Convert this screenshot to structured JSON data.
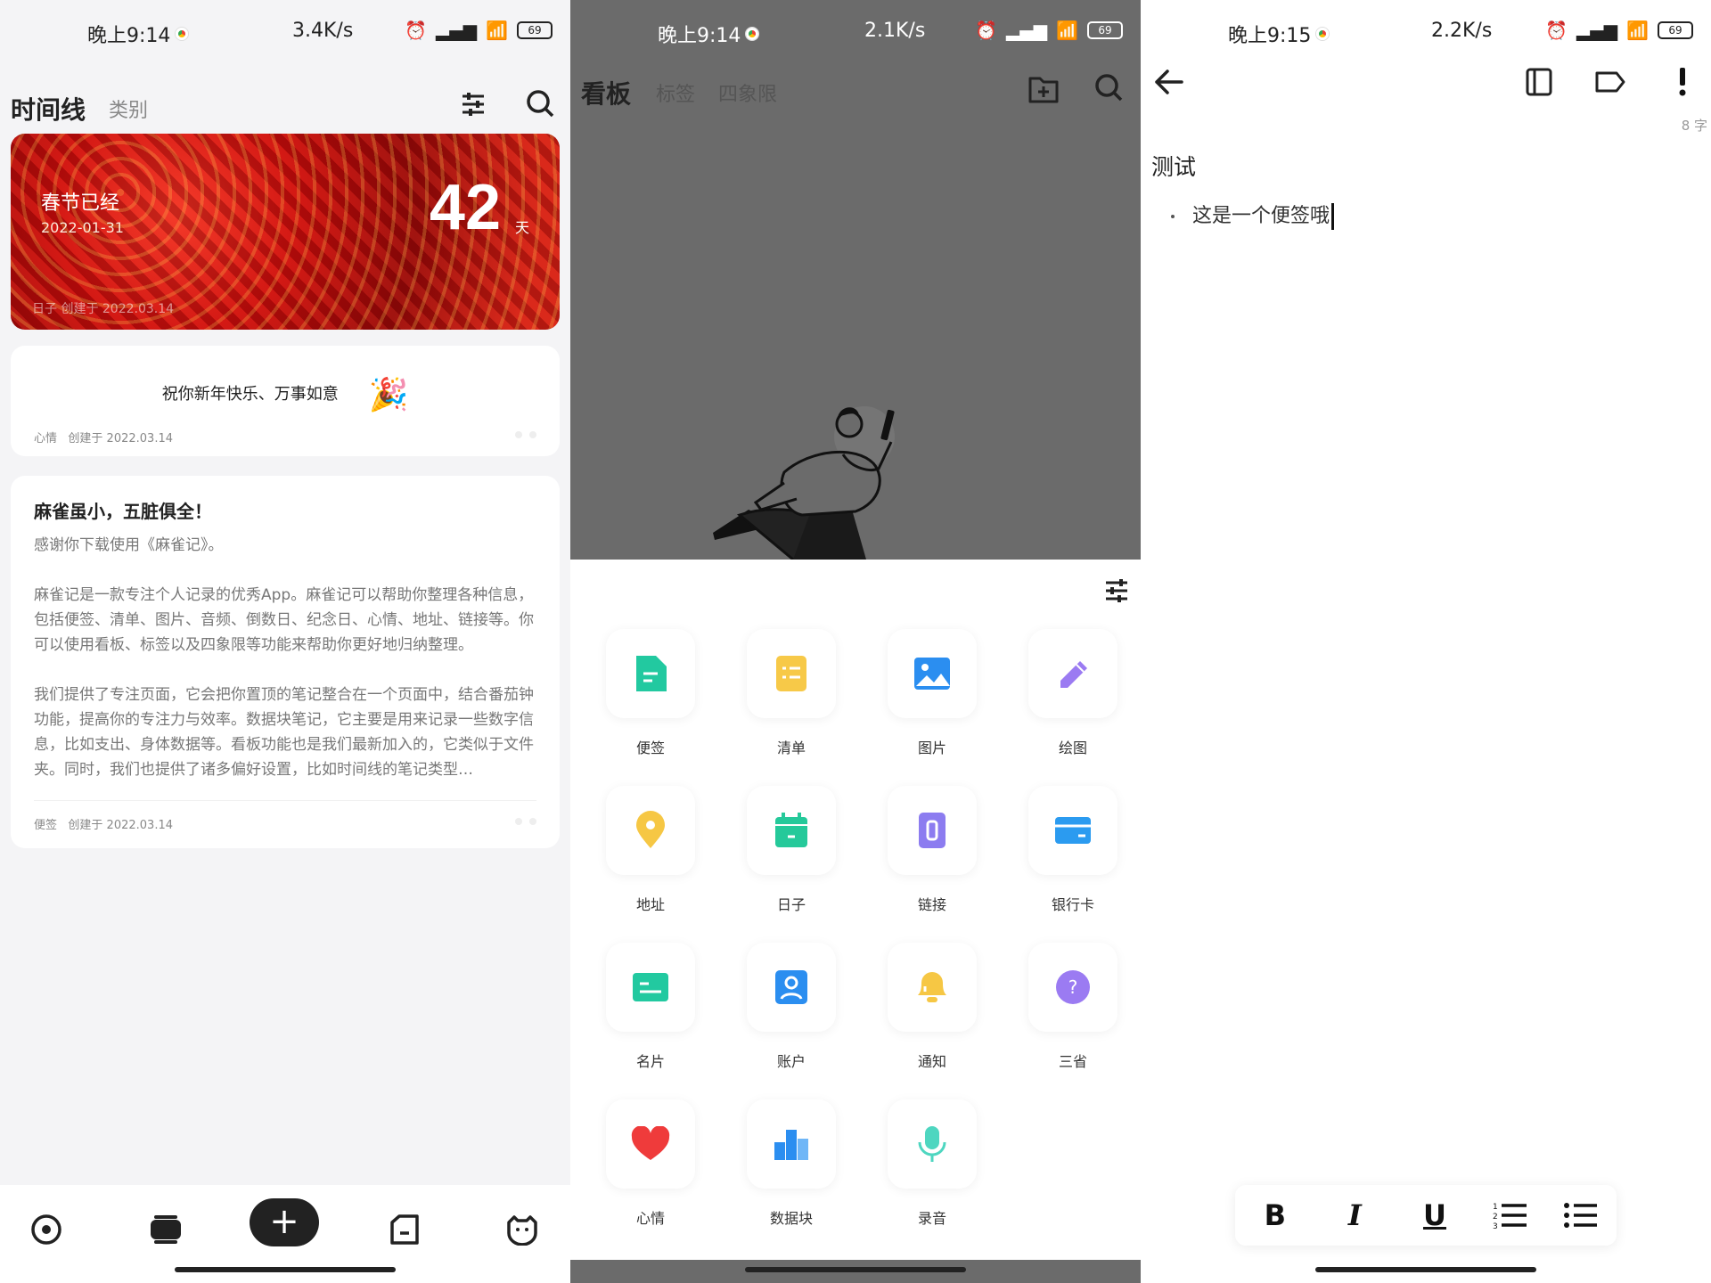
{
  "left": {
    "status": {
      "time": "晚上9:14",
      "speed": "3.4K/s",
      "battery": "69"
    },
    "tabs": {
      "active": "时间线",
      "other": "类别"
    },
    "banner": {
      "title": "春节已经",
      "date": "2022-01-31",
      "number": "42",
      "unit": "天",
      "meta": "日子   创建于 2022.03.14"
    },
    "card1": {
      "text": "祝你新年快乐、万事如意",
      "emoji": "🎉",
      "category": "心情",
      "created": "创建于 2022.03.14"
    },
    "card2": {
      "title": "麻雀虽小，五脏俱全！",
      "p1": "感谢你下载使用《麻雀记》。",
      "p2": "麻雀记是一款专注个人记录的优秀App。麻雀记可以帮助你整理各种信息，包括便签、清单、图片、音频、倒数日、纪念日、心情、地址、链接等。你可以使用看板、标签以及四象限等功能来帮助你更好地归纳整理。",
      "p3": "我们提供了专注页面，它会把你置顶的笔记整合在一个页面中，结合番茄钟功能，提高你的专注力与效率。数据块笔记，它主要是用来记录一些数字信息，比如支出、身体数据等。看板功能也是我们最新加入的，它类似于文件夹。同时，我们也提供了诸多偏好设置，比如时间线的笔记类型…",
      "category": "便签",
      "created": "创建于 2022.03.14"
    },
    "add_label": "+"
  },
  "middle": {
    "status": {
      "time": "晚上9:14",
      "speed": "2.1K/s",
      "battery": "69"
    },
    "tabs": {
      "active": "看板",
      "tab2": "标签",
      "tab3": "四象限"
    },
    "types": [
      {
        "label": "便签",
        "color": "#22c9a0",
        "icon": "note"
      },
      {
        "label": "清单",
        "color": "#f7c948",
        "icon": "list"
      },
      {
        "label": "图片",
        "color": "#2b8ef0",
        "icon": "image"
      },
      {
        "label": "绘图",
        "color": "#9b7bf2",
        "icon": "pen"
      },
      {
        "label": "地址",
        "color": "#f6c744",
        "icon": "location"
      },
      {
        "label": "日子",
        "color": "#25c99a",
        "icon": "calendar"
      },
      {
        "label": "链接",
        "color": "#8c7cf0",
        "icon": "link"
      },
      {
        "label": "银行卡",
        "color": "#2b9bf0",
        "icon": "card"
      },
      {
        "label": "名片",
        "color": "#22c9a0",
        "icon": "namecard"
      },
      {
        "label": "账户",
        "color": "#2b8ef0",
        "icon": "account"
      },
      {
        "label": "通知",
        "color": "#f6c744",
        "icon": "bell"
      },
      {
        "label": "三省",
        "color": "#9b7bf2",
        "icon": "question"
      },
      {
        "label": "心情",
        "color": "#ef3b3b",
        "icon": "heart"
      },
      {
        "label": "数据块",
        "color": "#2b8ef0",
        "icon": "chart"
      },
      {
        "label": "录音",
        "color": "#4ed6c0",
        "icon": "mic"
      }
    ]
  },
  "right": {
    "status": {
      "time": "晚上9:15",
      "speed": "2.2K/s",
      "battery": "69"
    },
    "char_count": "8 字",
    "title": "测试",
    "bullet": "这是一个便签哦",
    "format": {
      "bold": "B",
      "italic": "I",
      "underline": "U"
    }
  }
}
